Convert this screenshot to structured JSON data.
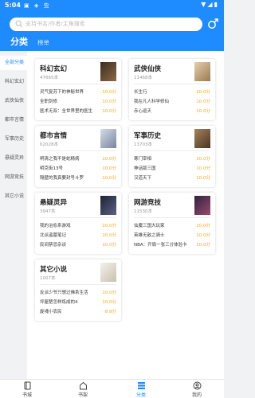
{
  "status": {
    "time": "5:04",
    "icons": "▣ ◈ 虫",
    "right": "▼◢▮"
  },
  "search": {
    "placeholder": "支持书名/作者/主角搜索"
  },
  "tabs": {
    "active": "分类",
    "inactive": "榜单"
  },
  "sidebar": {
    "items": [
      {
        "label": "全部分类",
        "active": true
      },
      {
        "label": "科幻玄幻",
        "active": false
      },
      {
        "label": "武侠仙侠",
        "active": false
      },
      {
        "label": "都市言情",
        "active": false
      },
      {
        "label": "军事历史",
        "active": false
      },
      {
        "label": "悬疑灵异",
        "active": false
      },
      {
        "label": "网游竞技",
        "active": false
      },
      {
        "label": "其它小说",
        "active": false
      }
    ]
  },
  "cards": [
    {
      "title": "科幻玄幻",
      "count": "47665本",
      "cover": "#6b4f3a",
      "books": [
        {
          "title": "灵气复苏下的神秘世界",
          "status": "10.0分"
        },
        {
          "title": "全职剑修",
          "status": "10.0分"
        },
        {
          "title": "医术无双：全世界里的医生",
          "status": "10.0分"
        }
      ]
    },
    {
      "title": "武侠仙侠",
      "count": "11468本",
      "cover": "#c9a87a",
      "books": [
        {
          "title": "长生行",
          "status": "10.0分"
        },
        {
          "title": "我在凡人科学修仙",
          "status": "10.0分"
        },
        {
          "title": "赤心巡天",
          "status": "10.0分"
        }
      ]
    },
    {
      "title": "都市言情",
      "count": "62028本",
      "cover": "#a8b3c8",
      "books": [
        {
          "title": "明清之我不是蛇精病",
          "status": "10.0分"
        },
        {
          "title": "明克街13号",
          "status": "10.0分"
        },
        {
          "title": "隔壁的我真要封号斗罗",
          "status": "10.0分"
        }
      ]
    },
    {
      "title": "军事历史",
      "count": "13703本",
      "cover": "#7a5b3f",
      "books": [
        {
          "title": "寒门宰相",
          "status": "10.0分"
        },
        {
          "title": "神话版三国",
          "status": "10.0分"
        },
        {
          "title": "汉道天下",
          "status": "10.0分"
        }
      ]
    },
    {
      "title": "悬疑灵异",
      "count": "3947本",
      "cover": "#3a3f55",
      "books": [
        {
          "title": "我的治愈系游戏",
          "status": "10.0分"
        },
        {
          "title": "北派盗墓笔记",
          "status": "10.0分"
        },
        {
          "title": "民间禁忌杂谈",
          "status": "10.0分"
        }
      ]
    },
    {
      "title": "网游竞技",
      "count": "11530本",
      "cover": "#4a3a5e",
      "books": [
        {
          "title": "仙魔三国大玩家",
          "status": "10.0分"
        },
        {
          "title": "英雄无敌之骑士",
          "status": "10.0分"
        },
        {
          "title": "NBA：开局一张三分体验卡",
          "status": "10.0分"
        }
      ]
    },
    {
      "title": "其它小说",
      "count": "1007本",
      "cover": "#e8e6df",
      "books": [
        {
          "title": "反派少爷只想过佛系生活",
          "status": "10.0分"
        },
        {
          "title": "坪屋楚怎样炼成的4",
          "status": "10.0分"
        },
        {
          "title": "旋魂小农民",
          "status": "8.9分"
        }
      ]
    }
  ],
  "bottom_nav": [
    {
      "label": "书城",
      "icon": "book-icon",
      "active": false
    },
    {
      "label": "书架",
      "icon": "home-icon",
      "active": false
    },
    {
      "label": "分类",
      "icon": "category-icon",
      "active": true
    },
    {
      "label": "我的",
      "icon": "user-icon",
      "active": false
    }
  ],
  "colors": {
    "accent": "#1e8bff",
    "score": "#f5a623"
  }
}
